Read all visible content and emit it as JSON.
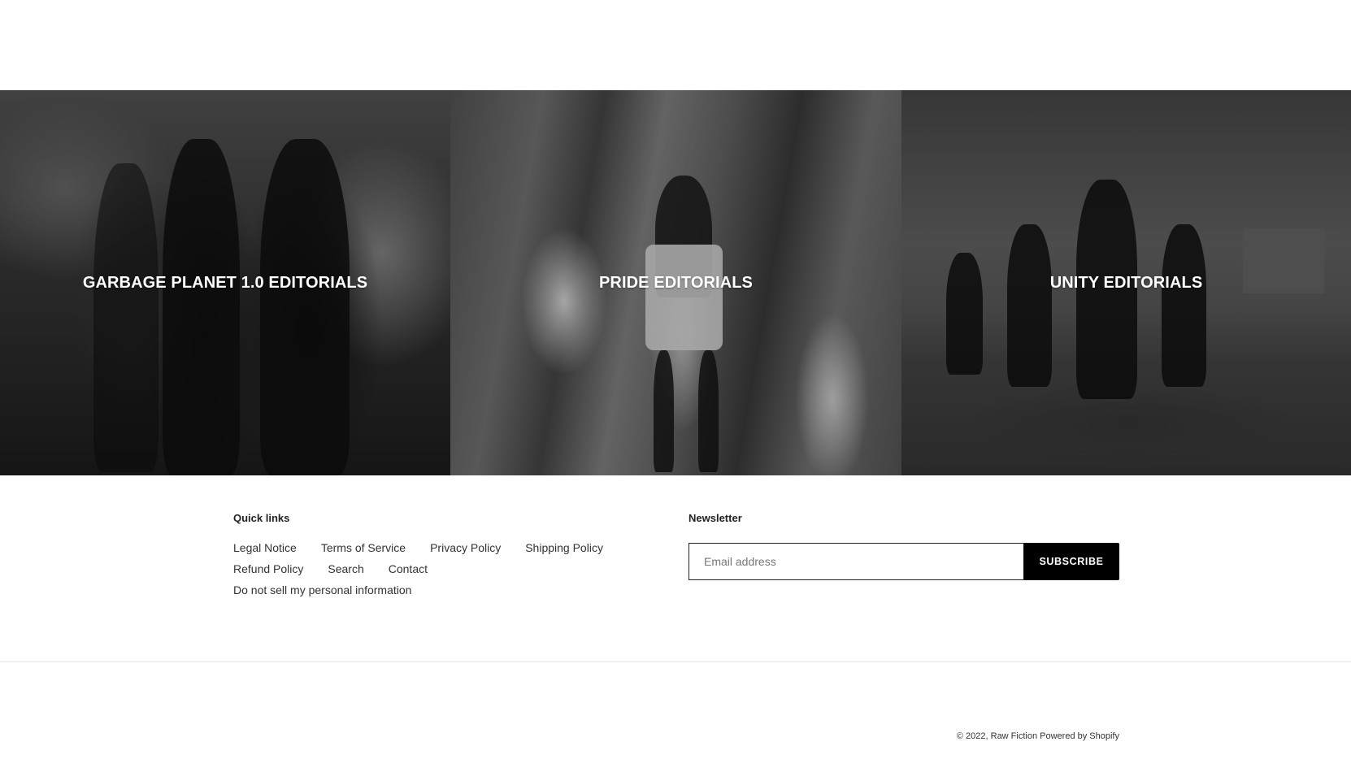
{
  "collections": [
    {
      "title": "GARBAGE PLANET 1.0 EDITORIALS"
    },
    {
      "title": "PRIDE EDITORIALS"
    },
    {
      "title": "UNITY EDITORIALS"
    }
  ],
  "footer": {
    "quick_links": {
      "heading": "Quick links",
      "items": [
        "Legal Notice",
        "Terms of Service",
        "Privacy Policy",
        "Shipping Policy",
        "Refund Policy",
        "Search",
        "Contact",
        "Do not sell my personal information"
      ]
    },
    "newsletter": {
      "heading": "Newsletter",
      "email_placeholder": "Email address",
      "subscribe_label": "SUBSCRIBE"
    },
    "copyright": {
      "prefix": "© 2022,",
      "brand": "Raw Fiction",
      "powered": "Powered by Shopify"
    }
  },
  "colors": {
    "button_bg": "#000000",
    "text": "#222222",
    "divider": "#e4e4e4"
  }
}
